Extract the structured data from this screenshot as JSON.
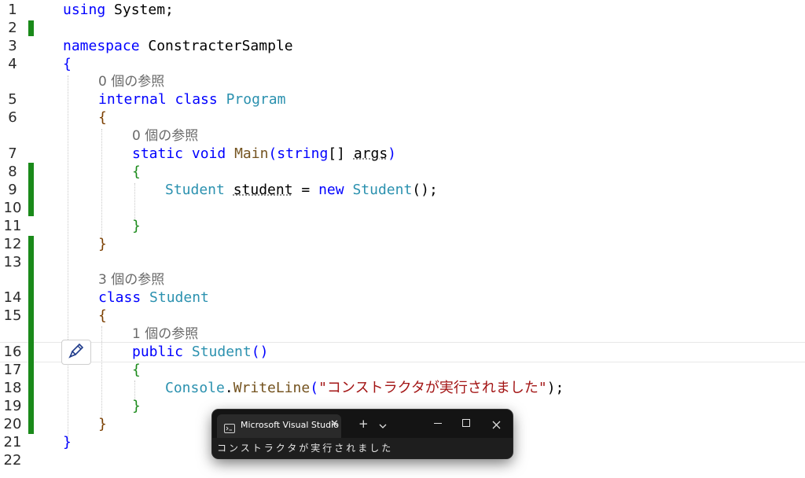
{
  "editor": {
    "line_numbers": [
      "1",
      "2",
      "3",
      "4",
      "5",
      "6",
      "7",
      "8",
      "9",
      "10",
      "11",
      "12",
      "13",
      "14",
      "15",
      "16",
      "17",
      "18",
      "19",
      "20",
      "21",
      "22"
    ],
    "code": {
      "l1_kw": "using",
      "l1_rest": " System;",
      "l3_kw": "namespace",
      "l3_rest": " ConstracterSample",
      "l4": "{",
      "lens_program": "0 個の参照",
      "l5_kw": "internal class",
      "l5_type": "Program",
      "l6": "{",
      "lens_main": "0 個の参照",
      "l7_kw1": "static void",
      "l7_fn": "Main",
      "l7_p1": "(",
      "l7_kw2": "string",
      "l7_p2": "[] ",
      "l7_arg": "args",
      "l7_p3": ")",
      "l8": "{",
      "l9_type1": "Student",
      "l9_var": "student",
      "l9_eq": " = ",
      "l9_kw": "new",
      "l9_type2": "Student",
      "l9_end": "();",
      "l11": "}",
      "l12": "}",
      "lens_student": "3 個の参照",
      "l14_kw": "class",
      "l14_type": "Student",
      "l15": "{",
      "lens_ctor": "1 個の参照",
      "l16_kw": "public",
      "l16_type": "Student",
      "l16_end": "()",
      "l17": "{",
      "l18_type": "Console",
      "l18_dot": ".",
      "l18_fn": "WriteLine",
      "l18_open": "(",
      "l18_str": "\"コンストラクタが実行されました\"",
      "l18_close": ");",
      "l19": "}",
      "l20": "}",
      "l21": "}"
    },
    "change_bar_color": "#1a8a1a",
    "hint_icon": "pencil-brush-icon"
  },
  "terminal": {
    "tab_title": "Microsoft Visual Studio",
    "close_glyph": "✕",
    "new_tab_glyph": "+",
    "output": "コンストラクタが実行されました"
  }
}
